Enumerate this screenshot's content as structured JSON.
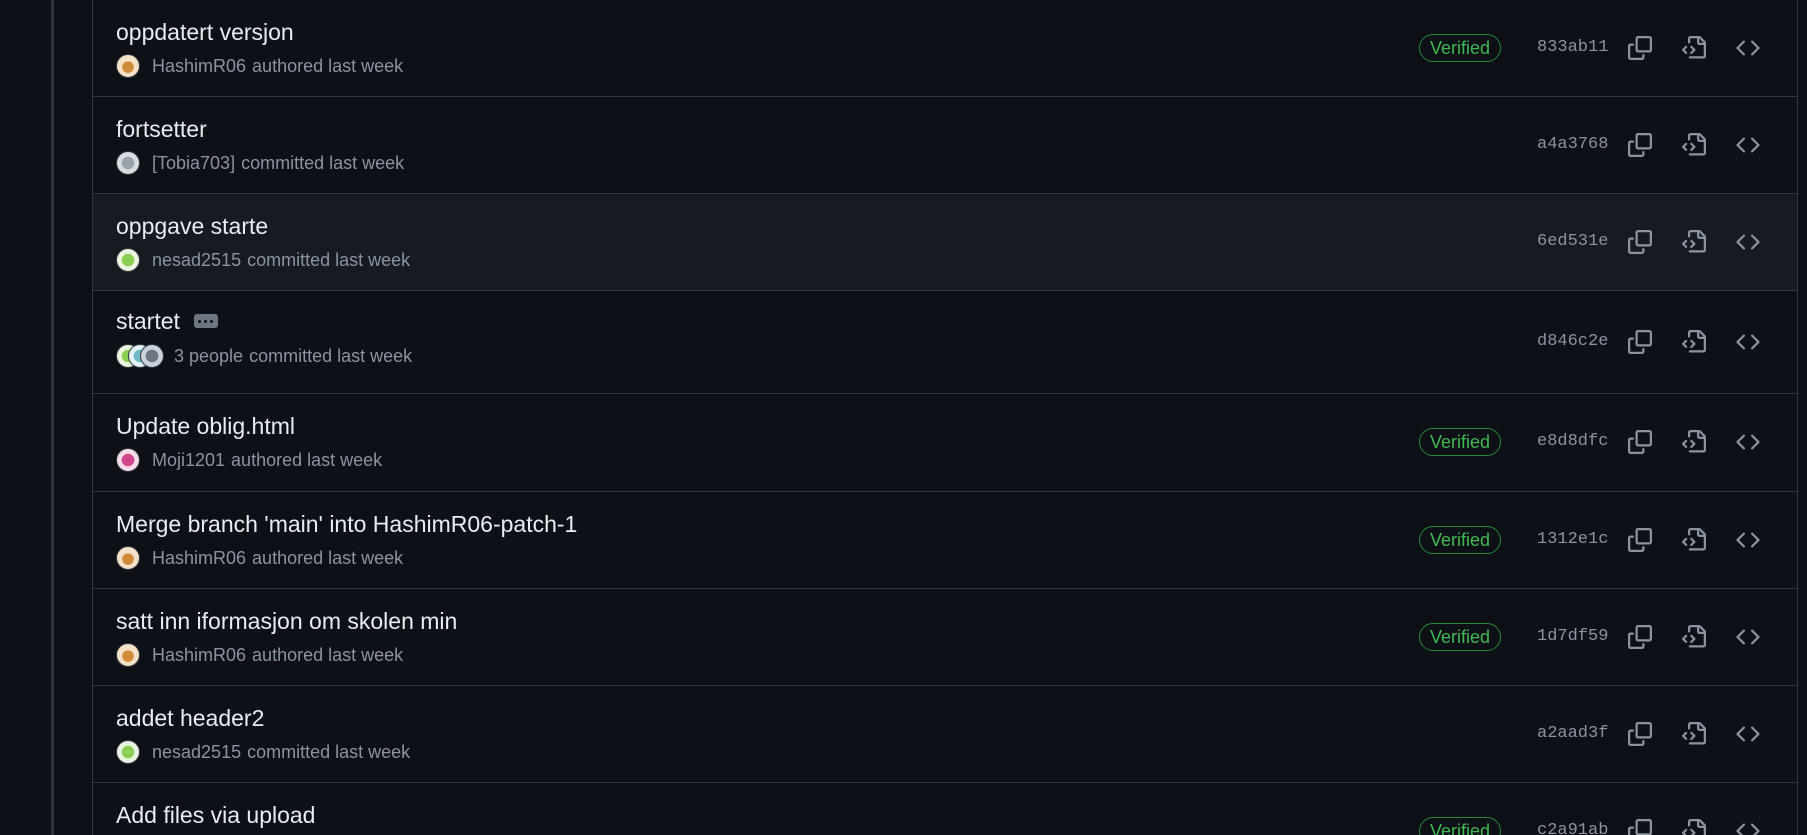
{
  "commits": [
    {
      "title": "oppdatert versjon",
      "user": "HashimR06",
      "action": "authored last week",
      "verified": "Verified",
      "sha": "833ab11",
      "avatar": "hashim"
    },
    {
      "title": "fortsetter",
      "user": "[Tobia703]",
      "action": "committed last week",
      "verified": "",
      "sha": "a4a3768",
      "avatar": "tobia"
    },
    {
      "title": "oppgave starte",
      "user": "nesad2515",
      "action": "committed last week",
      "verified": "",
      "sha": "6ed531e",
      "avatar": "nesad"
    },
    {
      "title": "startet",
      "user": "3 people",
      "action": "committed last week",
      "verified": "",
      "sha": "d846c2e",
      "avatar": "stack"
    },
    {
      "title": "Update oblig.html",
      "user": "Moji1201",
      "action": "authored last week",
      "verified": "Verified",
      "sha": "e8d8dfc",
      "avatar": "moji"
    },
    {
      "title": "Merge branch 'main' into HashimR06-patch-1",
      "user": "HashimR06",
      "action": "authored last week",
      "verified": "Verified",
      "sha": "1312e1c",
      "avatar": "hashim"
    },
    {
      "title": "satt inn iformasjon om skolen min",
      "user": "HashimR06",
      "action": "authored last week",
      "verified": "Verified",
      "sha": "1d7df59",
      "avatar": "hashim"
    },
    {
      "title": "addet header2",
      "user": "nesad2515",
      "action": "committed last week",
      "verified": "",
      "sha": "a2aad3f",
      "avatar": "nesad"
    },
    {
      "title": "Add files via upload",
      "user": "",
      "action": "",
      "verified": "Verified",
      "sha": "c2a91ab",
      "avatar": "none"
    }
  ],
  "icons": {
    "copy": "copy-icon",
    "browse": "file-code-icon",
    "code": "code-icon"
  },
  "colors": {
    "background": "#0d1117",
    "border": "#30363d",
    "muted": "#8b949e",
    "text": "#e6edf3",
    "verified": "#3fb950"
  }
}
